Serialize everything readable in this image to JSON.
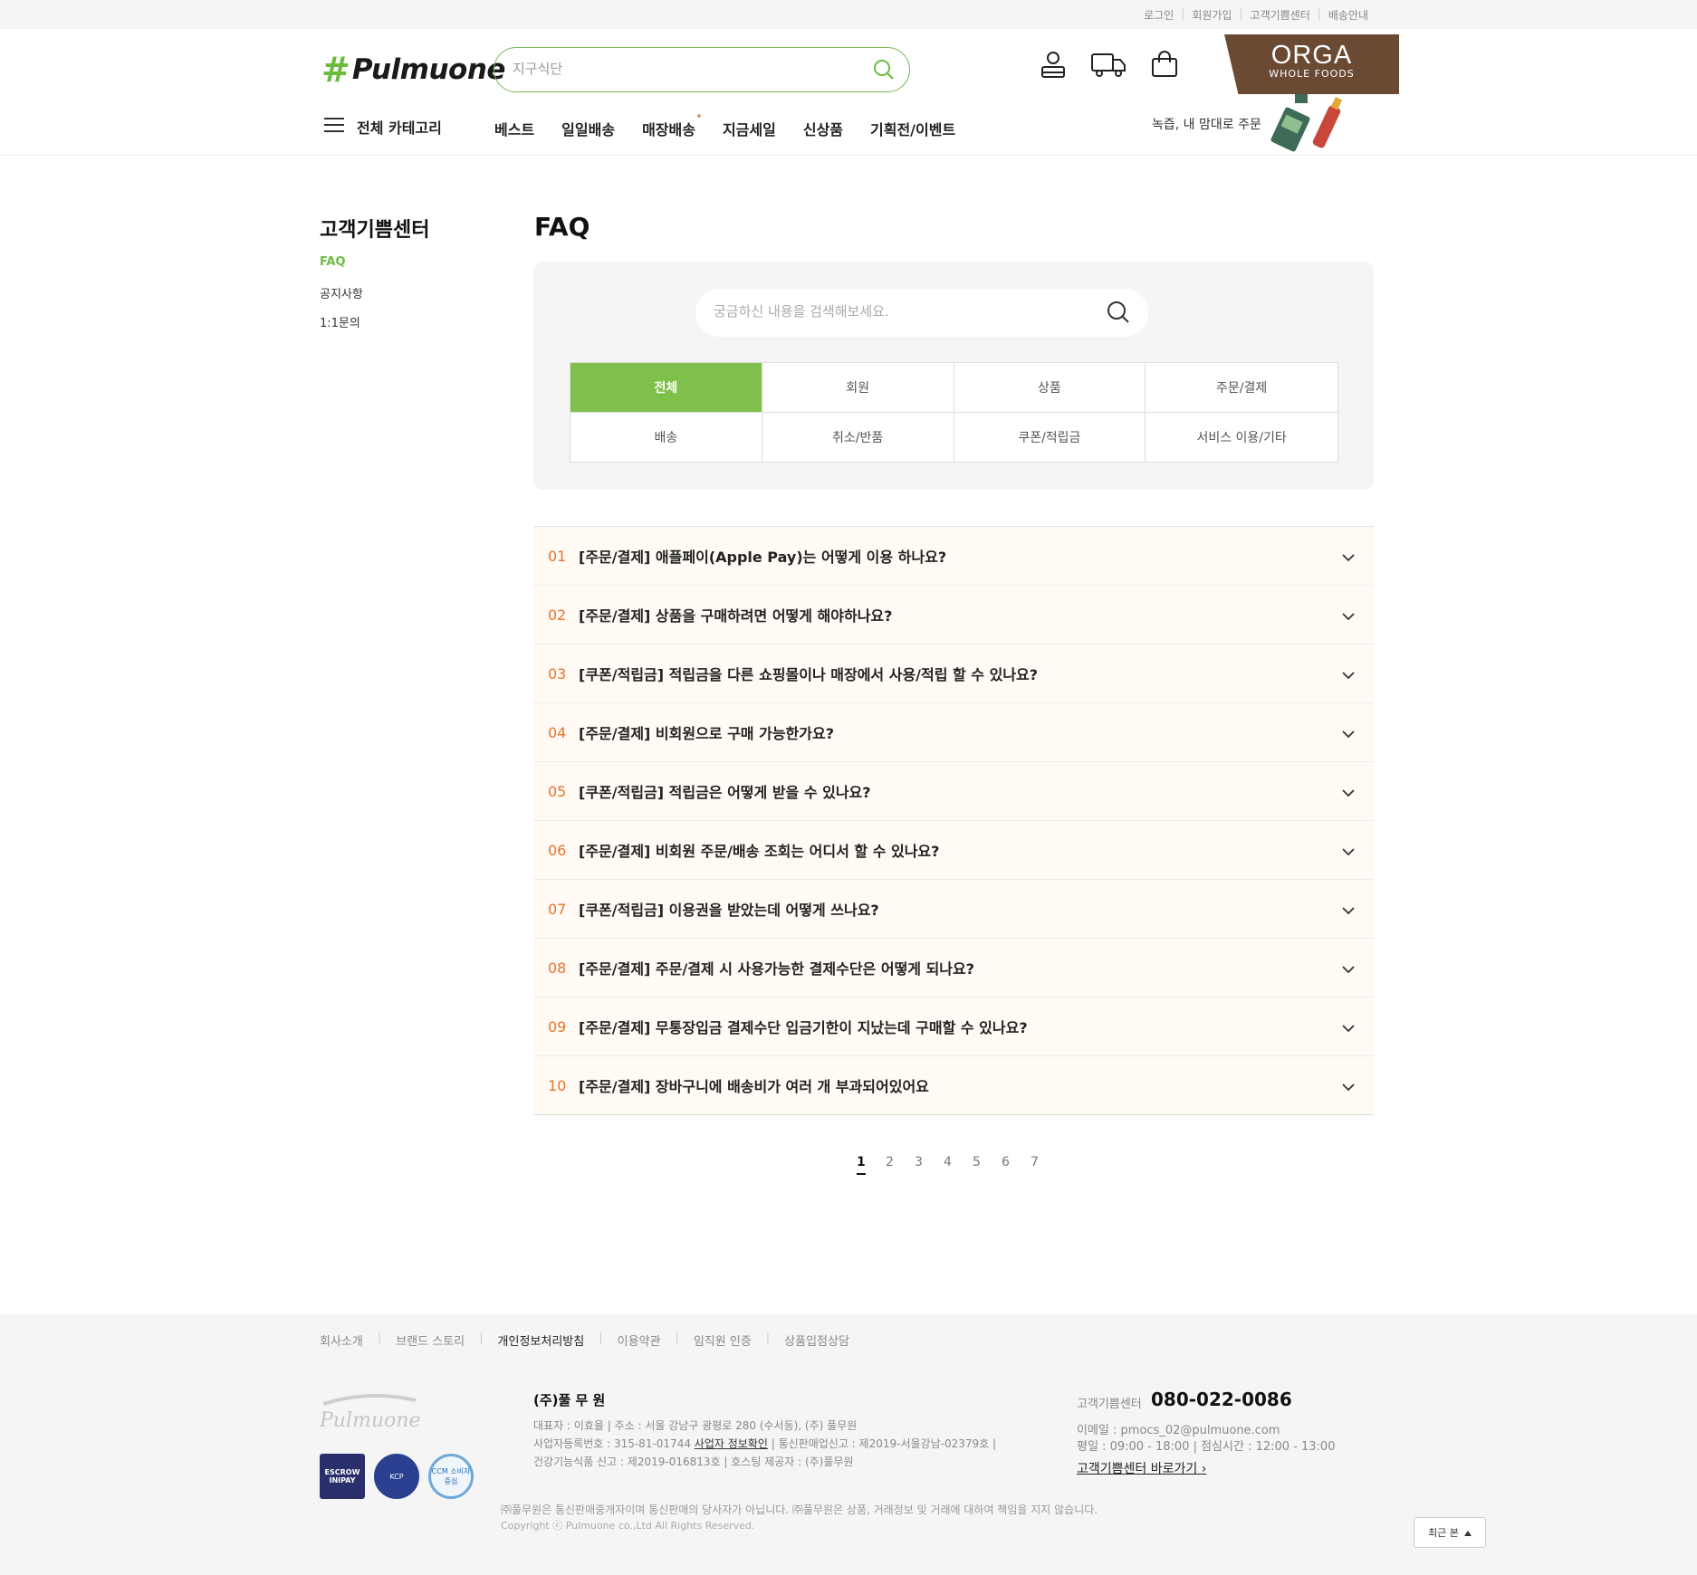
{
  "util_links": [
    "로그인",
    "회원가입",
    "고객기쁨센터",
    "배송안내"
  ],
  "header": {
    "logo_hash": "#",
    "logo_text": "Pulmuone",
    "search_placeholder": "지구식단",
    "orga": {
      "title": "ORGA",
      "subtitle": "WHOLE FOODS"
    }
  },
  "nav": {
    "all_categories": "전체 카테고리",
    "items": [
      "베스트",
      "일일배송",
      "매장배송",
      "지금세일",
      "신상품",
      "기획전/이벤트"
    ],
    "promo": "녹즙, 내 맘대로 주문"
  },
  "sidebar": {
    "title": "고객기쁨센터",
    "items": [
      "FAQ",
      "공지사항",
      "1:1문의"
    ]
  },
  "main": {
    "title": "FAQ",
    "search_placeholder": "궁금하신 내용을 검색해보세요.",
    "categories": [
      "전체",
      "회원",
      "상품",
      "주문/결제",
      "배송",
      "취소/반품",
      "쿠폰/적립금",
      "서비스 이용/기타"
    ],
    "faqs": [
      {
        "num": "01",
        "q": "[주문/결제] 애플페이(Apple Pay)는 어떻게 이용 하나요?"
      },
      {
        "num": "02",
        "q": "[주문/결제] 상품을 구매하려면 어떻게 해야하나요?"
      },
      {
        "num": "03",
        "q": "[쿠폰/적립금] 적립금을 다른 쇼핑몰이나 매장에서 사용/적립 할 수 있나요?"
      },
      {
        "num": "04",
        "q": "[주문/결제] 비회원으로 구매 가능한가요?"
      },
      {
        "num": "05",
        "q": "[쿠폰/적립금] 적립금은 어떻게 받을 수 있나요?"
      },
      {
        "num": "06",
        "q": "[주문/결제] 비회원 주문/배송 조회는 어디서 할 수 있나요?"
      },
      {
        "num": "07",
        "q": "[쿠폰/적립금] 이용권을 받았는데 어떻게 쓰나요?"
      },
      {
        "num": "08",
        "q": "[주문/결제] 주문/결제 시 사용가능한 결제수단은 어떻게 되나요?"
      },
      {
        "num": "09",
        "q": "[주문/결제] 무통장입금 결제수단 입금기한이 지났는데 구매할 수 있나요?"
      },
      {
        "num": "10",
        "q": "[주문/결제] 장바구니에 배송비가 여러 개 부과되어있어요"
      }
    ],
    "pages": [
      "1",
      "2",
      "3",
      "4",
      "5",
      "6",
      "7"
    ]
  },
  "footer": {
    "links": [
      "회사소개",
      "브랜드 스토리",
      "개인정보처리방침",
      "이용약관",
      "임직원 인증",
      "상품입점상담"
    ],
    "logo_text": "Pulmuone",
    "badges": {
      "escrow": "ESCROW INIPAY",
      "kcp": "KCP",
      "ccm": "CCM 소비자중심"
    },
    "company": "(주)풀 무 원",
    "info1": "대표자 : 이효율 | 주소 : 서울 강남구 광평로 280 (수서동), (주) 풀무원",
    "info2a": "사업자등록번호 : 315-81-01744",
    "info2_link": "사업자 정보확인",
    "info2b": "| 통신판매업신고 : 제2019-서울강남-02379호 |",
    "info3": "건강기능식품 신고 : 제2019-016813호 | 호스팅 제공자 : (주)풀무원",
    "cs_label": "고객기쁨센터",
    "cs_phone": "080-022-0086",
    "cs_email": "이메일 : pmocs_02@pulmuone.com",
    "cs_hours": "평일 : 09:00 - 18:00 | 점심시간 : 12:00 - 13:00",
    "cs_link": "고객기쁨센터 바로가기",
    "disclaimer": "㈜풀무원은 통신판매중개자이며 통신판매의 당사자가 아닙니다. ㈜풀무원은 상품, 거래정보 및 거래에 대하여 책임을 지지 않습니다.",
    "copyright": "Copyright ⓒ Pulmuone co.,Ltd All Rights Reserved.",
    "recent": "최근 본"
  },
  "colors": {
    "accent_green": "#7ec04a",
    "faq_number": "#e8732b",
    "orga_brown": "#6b4a34"
  }
}
